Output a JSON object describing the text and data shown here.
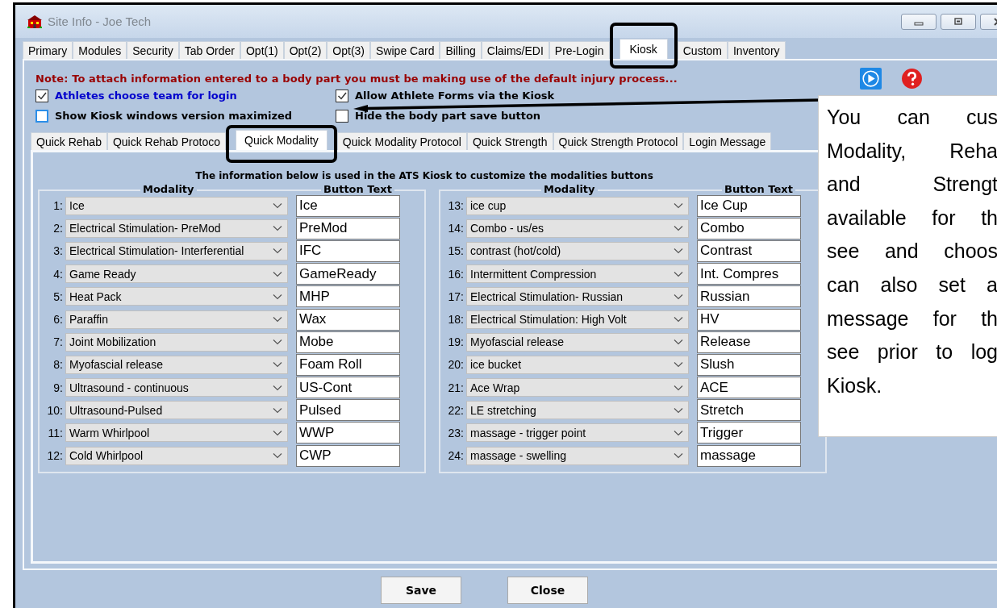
{
  "window": {
    "title": "Site Info - Joe Tech"
  },
  "tabs": [
    {
      "label": "Primary",
      "selected": false
    },
    {
      "label": "Modules",
      "selected": false
    },
    {
      "label": "Security",
      "selected": false
    },
    {
      "label": "Tab Order",
      "selected": false
    },
    {
      "label": "Opt(1)",
      "selected": false
    },
    {
      "label": "Opt(2)",
      "selected": false
    },
    {
      "label": "Opt(3)",
      "selected": false
    },
    {
      "label": "Swipe Card",
      "selected": false
    },
    {
      "label": "Billing",
      "selected": false
    },
    {
      "label": "Claims/EDI",
      "selected": false
    },
    {
      "label": "Pre-Login",
      "selected": false
    },
    {
      "label": "Kiosk",
      "selected": true
    },
    {
      "label": "Custom",
      "selected": false
    },
    {
      "label": "Inventory",
      "selected": false
    }
  ],
  "note": "Note:  To attach information entered to a body part you must be making use of the default injury process...",
  "options": [
    {
      "label": "Athletes choose team for login",
      "checked": true,
      "color": "#0000cc"
    },
    {
      "label": "Allow Athlete Forms via the Kiosk",
      "checked": true,
      "color": "#000000"
    },
    {
      "label": "Show Kiosk windows version maximized",
      "checked": false,
      "color": "#000000"
    },
    {
      "label": "Hide the body part save button",
      "checked": false,
      "color": "#000000"
    }
  ],
  "subtabs": [
    {
      "label": "Quick Rehab",
      "selected": false
    },
    {
      "label": "Quick Rehab Protoco",
      "selected": false
    },
    {
      "label": "Quick Modality",
      "selected": true
    },
    {
      "label": "Quick Modality Protocol",
      "selected": false
    },
    {
      "label": "Quick Strength",
      "selected": false
    },
    {
      "label": "Quick Strength Protocol",
      "selected": false
    },
    {
      "label": "Login Message",
      "selected": false
    }
  ],
  "description": "The information below is used in the ATS Kiosk to customize the modalities buttons",
  "groups": [
    {
      "modality_header": "Modality",
      "button_header": "Button Text",
      "rows": [
        {
          "number": "1:",
          "modality": "Ice",
          "button_text": "Ice"
        },
        {
          "number": "2:",
          "modality": "Electrical Stimulation- PreMod",
          "button_text": "PreMod"
        },
        {
          "number": "3:",
          "modality": "Electrical Stimulation- Interferential",
          "button_text": "IFC"
        },
        {
          "number": "4:",
          "modality": "Game Ready",
          "button_text": "GameReady"
        },
        {
          "number": "5:",
          "modality": "Heat Pack",
          "button_text": "MHP"
        },
        {
          "number": "6:",
          "modality": "Paraffin",
          "button_text": "Wax"
        },
        {
          "number": "7:",
          "modality": "Joint Mobilization",
          "button_text": "Mobe"
        },
        {
          "number": "8:",
          "modality": "Myofascial release",
          "button_text": "Foam Roll"
        },
        {
          "number": "9:",
          "modality": "Ultrasound - continuous",
          "button_text": "US-Cont"
        },
        {
          "number": "10:",
          "modality": "Ultrasound-Pulsed",
          "button_text": "Pulsed"
        },
        {
          "number": "11:",
          "modality": "Warm Whirlpool",
          "button_text": "WWP"
        },
        {
          "number": "12:",
          "modality": "Cold Whirlpool",
          "button_text": "CWP"
        }
      ]
    },
    {
      "modality_header": "Modality",
      "button_header": "Button Text",
      "rows": [
        {
          "number": "13:",
          "modality": "ice cup",
          "button_text": "Ice Cup"
        },
        {
          "number": "14:",
          "modality": "Combo - us/es",
          "button_text": "Combo"
        },
        {
          "number": "15:",
          "modality": "contrast (hot/cold)",
          "button_text": "Contrast"
        },
        {
          "number": "16:",
          "modality": "Intermittent Compression",
          "button_text": "Int. Compres"
        },
        {
          "number": "17:",
          "modality": "Electrical Stimulation- Russian",
          "button_text": "Russian"
        },
        {
          "number": "18:",
          "modality": "Electrical Stimulation: High Volt",
          "button_text": "HV"
        },
        {
          "number": "19:",
          "modality": "Myofascial release",
          "button_text": "Release"
        },
        {
          "number": "20:",
          "modality": "ice bucket",
          "button_text": "Slush"
        },
        {
          "number": "21:",
          "modality": "Ace Wrap",
          "button_text": "ACE"
        },
        {
          "number": "22:",
          "modality": "LE stretching",
          "button_text": "Stretch"
        },
        {
          "number": "23:",
          "modality": "massage - trigger point",
          "button_text": "Trigger"
        },
        {
          "number": "24:",
          "modality": "massage - swelling",
          "button_text": "massage"
        }
      ]
    }
  ],
  "buttons": [
    "Save",
    "Close"
  ],
  "callout": {
    "lines": [
      "You can cus",
      "Modality, Reha",
      "and Strengt",
      "available for th",
      "see and choos",
      "can also set a",
      "message for th",
      "see prior to log",
      "Kiosk."
    ]
  }
}
